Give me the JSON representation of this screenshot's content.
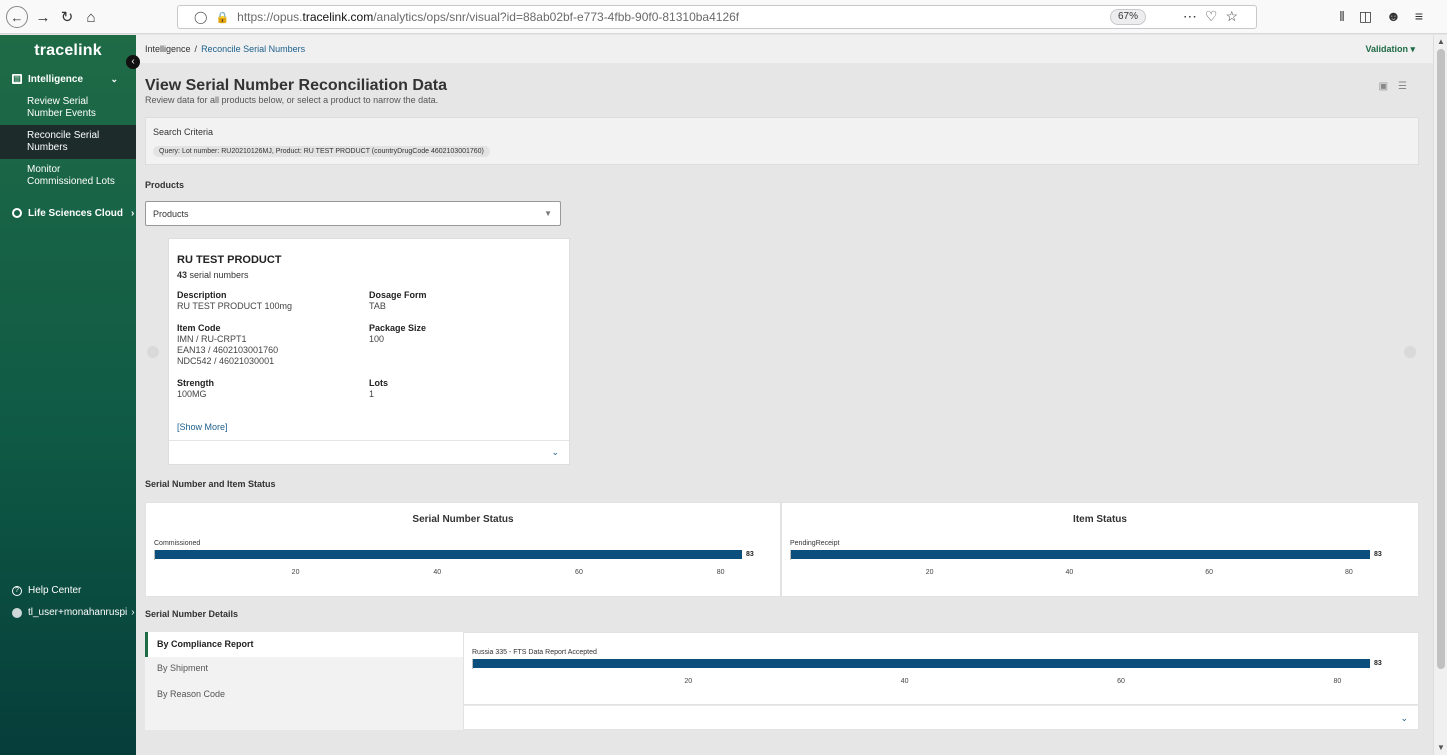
{
  "browser": {
    "url_prefix": "https://opus.",
    "url_domain": "tracelink.com",
    "url_path": "/analytics/ops/snr/visual?id=88ab02bf-e773-4fbb-90f0-81310ba4126f",
    "zoom": "67%"
  },
  "sidebar": {
    "brand": "tracelink",
    "section_label": "Intelligence",
    "items": [
      {
        "label": "Review Serial Number Events"
      },
      {
        "label": "Reconcile Serial Numbers"
      },
      {
        "label": "Monitor Commissioned Lots"
      }
    ],
    "cloud_label": "Life Sciences Cloud",
    "help_label": "Help Center",
    "user_label": "tl_user+monahanruspi"
  },
  "header": {
    "crumb_root": "Intelligence",
    "crumb_current": "Reconcile Serial Numbers",
    "env": "Validation"
  },
  "page": {
    "title": "View Serial Number Reconciliation Data",
    "subtitle": "Review data for all products below, or select a product to narrow the data."
  },
  "criteria": {
    "label": "Search Criteria",
    "query": "Query: Lot number: RU20210126MJ, Product: RU TEST PRODUCT (countryDrugCode 4602103001760)"
  },
  "products": {
    "heading": "Products",
    "select_value": "Products"
  },
  "product_card": {
    "name": "RU TEST PRODUCT",
    "count_num": "43",
    "count_text": " serial numbers",
    "description_label": "Description",
    "description": "RU TEST PRODUCT 100mg",
    "dosage_label": "Dosage Form",
    "dosage": "TAB",
    "item_code_label": "Item Code",
    "item_code_1": "IMN / RU-CRPT1",
    "item_code_2": "EAN13 / 4602103001760",
    "item_code_3": "NDC542 / 46021030001",
    "package_label": "Package Size",
    "package": "100",
    "strength_label": "Strength",
    "strength": "100MG",
    "lots_label": "Lots",
    "lots": "1",
    "show_more": "[Show More]"
  },
  "status_section": {
    "heading": "Serial Number and Item Status"
  },
  "details_section": {
    "heading": "Serial Number Details",
    "tabs": [
      {
        "label": "By Compliance Report"
      },
      {
        "label": "By Shipment"
      },
      {
        "label": "By Reason Code"
      }
    ]
  },
  "chart_data": [
    {
      "type": "bar",
      "title": "Serial Number Status",
      "categories": [
        "Commissioned"
      ],
      "values": [
        83
      ],
      "xlim": [
        0,
        83
      ],
      "ticks": [
        20,
        40,
        60,
        80
      ],
      "orientation": "horizontal"
    },
    {
      "type": "bar",
      "title": "Item Status",
      "categories": [
        "PendingReceipt"
      ],
      "values": [
        83
      ],
      "xlim": [
        0,
        83
      ],
      "ticks": [
        20,
        40,
        60,
        80
      ],
      "orientation": "horizontal"
    },
    {
      "type": "bar",
      "title": "",
      "categories": [
        "Russia 335 - FTS Data Report Accepted"
      ],
      "values": [
        83
      ],
      "xlim": [
        0,
        83
      ],
      "ticks": [
        20,
        40,
        60,
        80
      ],
      "orientation": "horizontal"
    }
  ],
  "colors": {
    "bar": "#0d4f7c",
    "brand_green": "#1f6b46",
    "link": "#1b5f8c"
  }
}
